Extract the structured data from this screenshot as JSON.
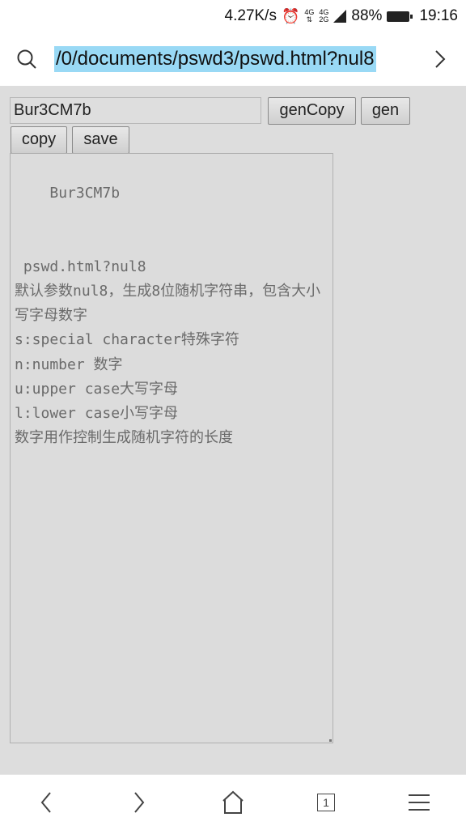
{
  "status_bar": {
    "speed": "4.27K/s",
    "alarm_icon": "alarm-clock-icon",
    "network_top": "4G",
    "network_bottom": "4G",
    "network_sub": "2G",
    "battery_percent": "88%",
    "time": "19:16"
  },
  "browser": {
    "url": "/0/documents/pswd3/pswd.html?nul8",
    "search_icon": "search-icon",
    "forward_icon": "chevron-right-icon"
  },
  "form": {
    "password_value": "Bur3CM7b",
    "gencopy_label": "genCopy",
    "gen_label": "gen",
    "copy_label": "copy",
    "save_label": "save",
    "textarea_content": "Bur3CM7b\n\n\n pswd.html?nul8\n默认参数nul8，生成8位随机字符串，包含大小写字母数字\ns:special character特殊字符\nn:number 数字\nu:upper case大写字母\nl:lower case小写字母\n数字用作控制生成随机字符的长度"
  },
  "bottom_nav": {
    "tabs_count": "1",
    "icons": [
      "back-icon",
      "forward-icon",
      "home-icon",
      "tabs-icon",
      "menu-icon"
    ]
  },
  "colors": {
    "url_highlight": "#99d9f5",
    "page_background": "#dddddd"
  }
}
